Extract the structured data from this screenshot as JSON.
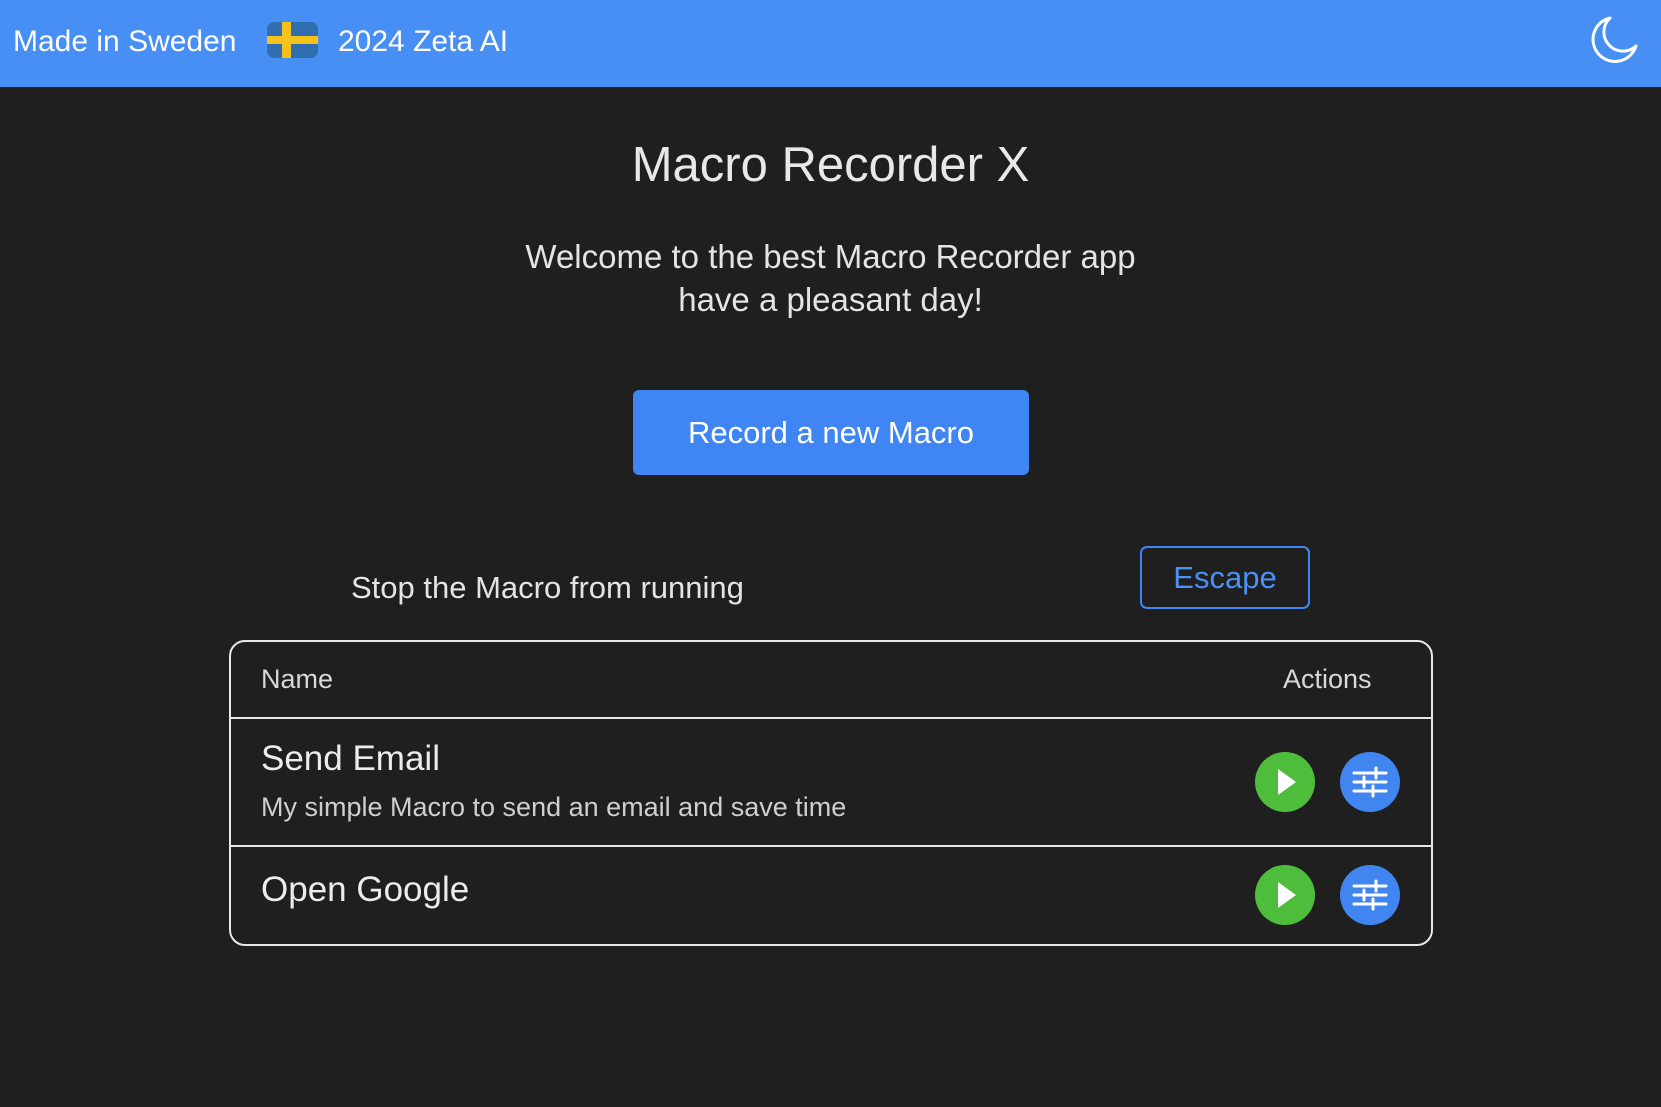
{
  "header": {
    "made_in": "Made in Sweden",
    "flag_icon": "sweden-flag-icon",
    "copyright": "2024 Zeta AI",
    "theme_toggle_icon": "moon-icon"
  },
  "main": {
    "title": "Macro Recorder X",
    "welcome_line1": "Welcome to the best Macro Recorder app",
    "welcome_line2": "have a pleasant day!",
    "record_button_label": "Record a new Macro",
    "stop_label": "Stop the Macro from running",
    "escape_button_label": "Escape"
  },
  "table": {
    "columns": [
      "Name",
      "Actions"
    ],
    "rows": [
      {
        "name": "Send Email",
        "description": "My simple Macro to send an email and save time",
        "play_icon": "play-icon",
        "settings_icon": "sliders-icon"
      },
      {
        "name": "Open Google",
        "description": "",
        "play_icon": "play-icon",
        "settings_icon": "sliders-icon"
      }
    ]
  },
  "colors": {
    "accent": "#478ef5",
    "background": "#1f1f1f",
    "play_green": "#4fbd3c",
    "settings_blue": "#4186f0",
    "flag_blue": "#2f6fb0",
    "flag_yellow": "#f4c21a"
  }
}
